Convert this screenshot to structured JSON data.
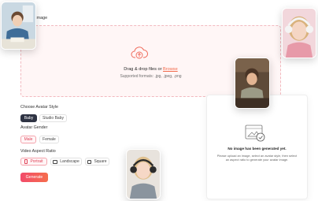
{
  "upload": {
    "label": "Upload Image",
    "drop_prefix": "Drag & drop files or ",
    "browse": "Browse",
    "formats": "Supported formats: .jpg, .jpeg, .png"
  },
  "avatar_style": {
    "label": "Choose Avatar Style",
    "options": [
      "Baby",
      "Studio Baby"
    ],
    "selected": "Baby"
  },
  "avatar_gender": {
    "label": "Avatar Gender",
    "options": [
      "Male",
      "Female"
    ],
    "selected": "Male"
  },
  "aspect_ratio": {
    "label": "Video Aspect Ratio",
    "options": [
      "Portrait",
      "Landscape",
      "Square"
    ],
    "selected": "Portrait"
  },
  "generate_label": "Generate",
  "result": {
    "title": "No image has been generated yet.",
    "subtitle": "Please upload an image, select an avatar style, then select an aspect ratio to generate your avatar image."
  },
  "colors": {
    "accent": "#f26a4b",
    "generate_start": "#f24b6a",
    "generate_end": "#f56d4d",
    "selected_dark": "#2f3444",
    "selected_pink": "#e0455a"
  }
}
